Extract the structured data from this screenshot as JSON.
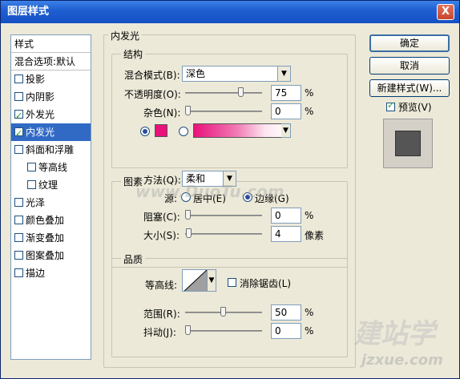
{
  "window": {
    "title": "图层样式",
    "close_glyph": "X"
  },
  "style_list": {
    "header": "样式",
    "blend_default": "混合选项:默认",
    "items": [
      {
        "label": "投影",
        "checked": false,
        "selected": false,
        "indent": false
      },
      {
        "label": "内阴影",
        "checked": false,
        "selected": false,
        "indent": false
      },
      {
        "label": "外发光",
        "checked": true,
        "selected": false,
        "indent": false
      },
      {
        "label": "内发光",
        "checked": true,
        "selected": true,
        "indent": false
      },
      {
        "label": "斜面和浮雕",
        "checked": false,
        "selected": false,
        "indent": false
      },
      {
        "label": "等高线",
        "checked": false,
        "selected": false,
        "indent": true
      },
      {
        "label": "纹理",
        "checked": false,
        "selected": false,
        "indent": true
      },
      {
        "label": "光泽",
        "checked": false,
        "selected": false,
        "indent": false
      },
      {
        "label": "颜色叠加",
        "checked": false,
        "selected": false,
        "indent": false
      },
      {
        "label": "渐变叠加",
        "checked": false,
        "selected": false,
        "indent": false
      },
      {
        "label": "图案叠加",
        "checked": false,
        "selected": false,
        "indent": false
      },
      {
        "label": "描边",
        "checked": false,
        "selected": false,
        "indent": false
      }
    ]
  },
  "inner_glow": {
    "title": "内发光",
    "structure": {
      "title": "结构",
      "blend_mode_label": "混合模式(B):",
      "blend_mode_value": "深色",
      "opacity_label": "不透明度(O):",
      "opacity_value": "75",
      "opacity_level": 0.75,
      "noise_label": "杂色(N):",
      "noise_value": "0",
      "noise_level": 0,
      "percent": "%",
      "color": "#e8127a"
    },
    "elements": {
      "title": "图素",
      "technique_label": "方法(Q):",
      "technique_value": "柔和",
      "source_label": "源:",
      "center_label": "居中(E)",
      "edge_label": "边缘(G)",
      "choke_label": "阻塞(C):",
      "choke_value": "0",
      "choke_level": 0,
      "size_label": "大小(S):",
      "size_value": "4",
      "size_unit": "像素",
      "percent": "%"
    },
    "quality": {
      "title": "品质",
      "contour_label": "等高线:",
      "anti_alias_label": "消除锯齿(L)",
      "range_label": "范围(R):",
      "range_value": "50",
      "range_level": 0.5,
      "jitter_label": "抖动(J):",
      "jitter_value": "0",
      "jitter_level": 0,
      "percent": "%"
    }
  },
  "buttons": {
    "ok": "确定",
    "cancel": "取消",
    "new_style": "新建样式(W)...",
    "preview_label": "预览(V)",
    "preview_checked": true
  },
  "watermarks": {
    "center": "www.DuoTu.com",
    "corner_brand": "建站学",
    "corner_url": "jzxue.com"
  }
}
